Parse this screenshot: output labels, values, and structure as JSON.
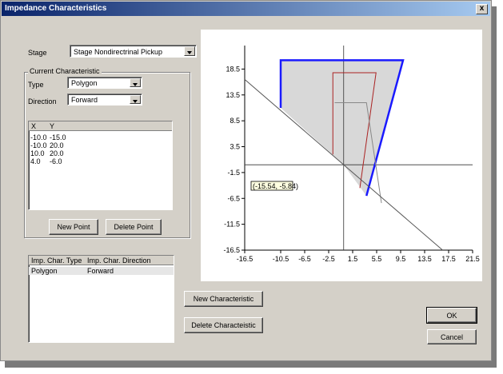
{
  "window": {
    "title": "Impedance Characteristics",
    "close": "x"
  },
  "stage": {
    "label": "Stage",
    "value": "Stage Nondirectrinal Pickup"
  },
  "current": {
    "group_label": "Current Characteristic",
    "type_label": "Type",
    "type_value": "Polygon",
    "direction_label": "Direction",
    "direction_value": "Forward"
  },
  "points_table": {
    "headers": [
      "X",
      "Y"
    ],
    "rows": [
      [
        "-10.0",
        "-15.0"
      ],
      [
        "-10.0",
        "20.0"
      ],
      [
        "10.0",
        "20.0"
      ],
      [
        "4.0",
        "-6.0"
      ]
    ]
  },
  "buttons": {
    "new_point": "New Point",
    "delete_point": "Delete Point",
    "new_characteristic": "New Characteristic",
    "delete_characteristic": "Delete Characteistic",
    "ok": "OK",
    "cancel": "Cancel"
  },
  "char_table": {
    "headers": [
      "Imp. Char. Type",
      "Imp. Char. Direction"
    ],
    "rows": [
      [
        "Polygon",
        "Forward"
      ]
    ]
  },
  "chart_data": {
    "type": "line",
    "xlim": [
      -16.5,
      21.5
    ],
    "ylim": [
      -16.5,
      21.5
    ],
    "x_ticks": [
      "-16.5",
      "-10.5",
      "-6.5",
      "-2.5",
      "1.5",
      "5.5",
      "9.5",
      "13.5",
      "17.5",
      "21.5"
    ],
    "y_ticks": [
      "18.5",
      "13.5",
      "8.5",
      "3.5",
      "-1.5",
      "-6.5",
      "-11.5",
      "-16.5"
    ],
    "annotation": "(-15.54, -5.84)",
    "series": [
      {
        "color": "#1a1aff",
        "points": [
          [
            -10.5,
            11.0
          ],
          [
            -10.5,
            20.2
          ],
          [
            9.9,
            20.2
          ],
          [
            3.8,
            -6.0
          ]
        ]
      },
      {
        "color": "#aa2222",
        "points": [
          [
            -1.8,
            2.0
          ],
          [
            -1.8,
            17.8
          ],
          [
            5.4,
            17.8
          ],
          [
            2.7,
            -4.5
          ]
        ]
      },
      {
        "color": "#888888",
        "points": [
          [
            -1.5,
            12.0
          ],
          [
            3.8,
            12.0
          ],
          [
            6.3,
            -7.4
          ]
        ]
      },
      {
        "color": "#555555",
        "points": [
          [
            -16.5,
            16.5
          ],
          [
            16.5,
            -16.5
          ]
        ]
      }
    ],
    "fill_polygon": [
      [
        -10.5,
        11.0
      ],
      [
        -10.5,
        20.2
      ],
      [
        9.9,
        20.2
      ],
      [
        3.8,
        -6.0
      ],
      [
        0,
        0
      ]
    ],
    "fill_color": "#d8d8d8"
  }
}
